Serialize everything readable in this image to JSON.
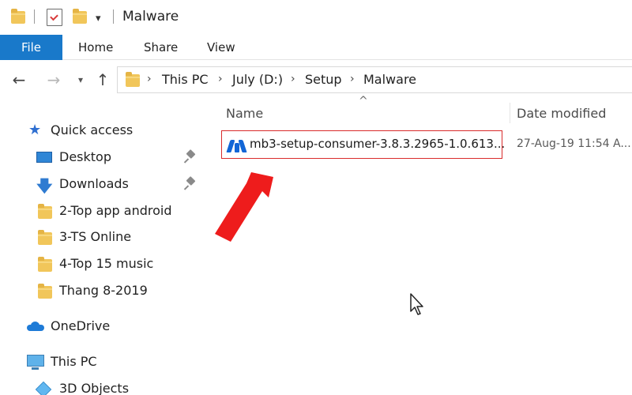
{
  "window": {
    "title": "Malware",
    "qa_dropdown_glyph": "▾"
  },
  "ribbon": {
    "tabs": [
      "File",
      "Home",
      "Share",
      "View"
    ]
  },
  "nav": {
    "back_glyph": "←",
    "forward_glyph": "→",
    "recent_glyph": "▾",
    "up_glyph": "↑"
  },
  "address": {
    "separator": "›",
    "crumbs": [
      "This PC",
      "July (D:)",
      "Setup",
      "Malware"
    ]
  },
  "navpane": {
    "quick_access": "Quick access",
    "items": [
      {
        "label": "Desktop",
        "pinned": true
      },
      {
        "label": "Downloads",
        "pinned": true
      },
      {
        "label": "2-Top app android",
        "pinned": false
      },
      {
        "label": "3-TS Online",
        "pinned": false
      },
      {
        "label": "4-Top 15 music",
        "pinned": false
      },
      {
        "label": "Thang 8-2019",
        "pinned": false
      }
    ],
    "onedrive": "OneDrive",
    "this_pc": "This PC",
    "objects_3d": "3D Objects"
  },
  "columns": {
    "sort_glyph": "^",
    "name": "Name",
    "date_modified": "Date modified"
  },
  "files": [
    {
      "name": "mb3-setup-consumer-3.8.3.2965-1.0.613...",
      "date_modified": "27-Aug-19 11:54 A..."
    }
  ],
  "colors": {
    "accent": "#1979ca",
    "highlight_border": "#d92b2b",
    "annotation_arrow": "#ee1c1c",
    "folder": "#f1c65a",
    "malwarebytes_blue": "#1266d6"
  }
}
